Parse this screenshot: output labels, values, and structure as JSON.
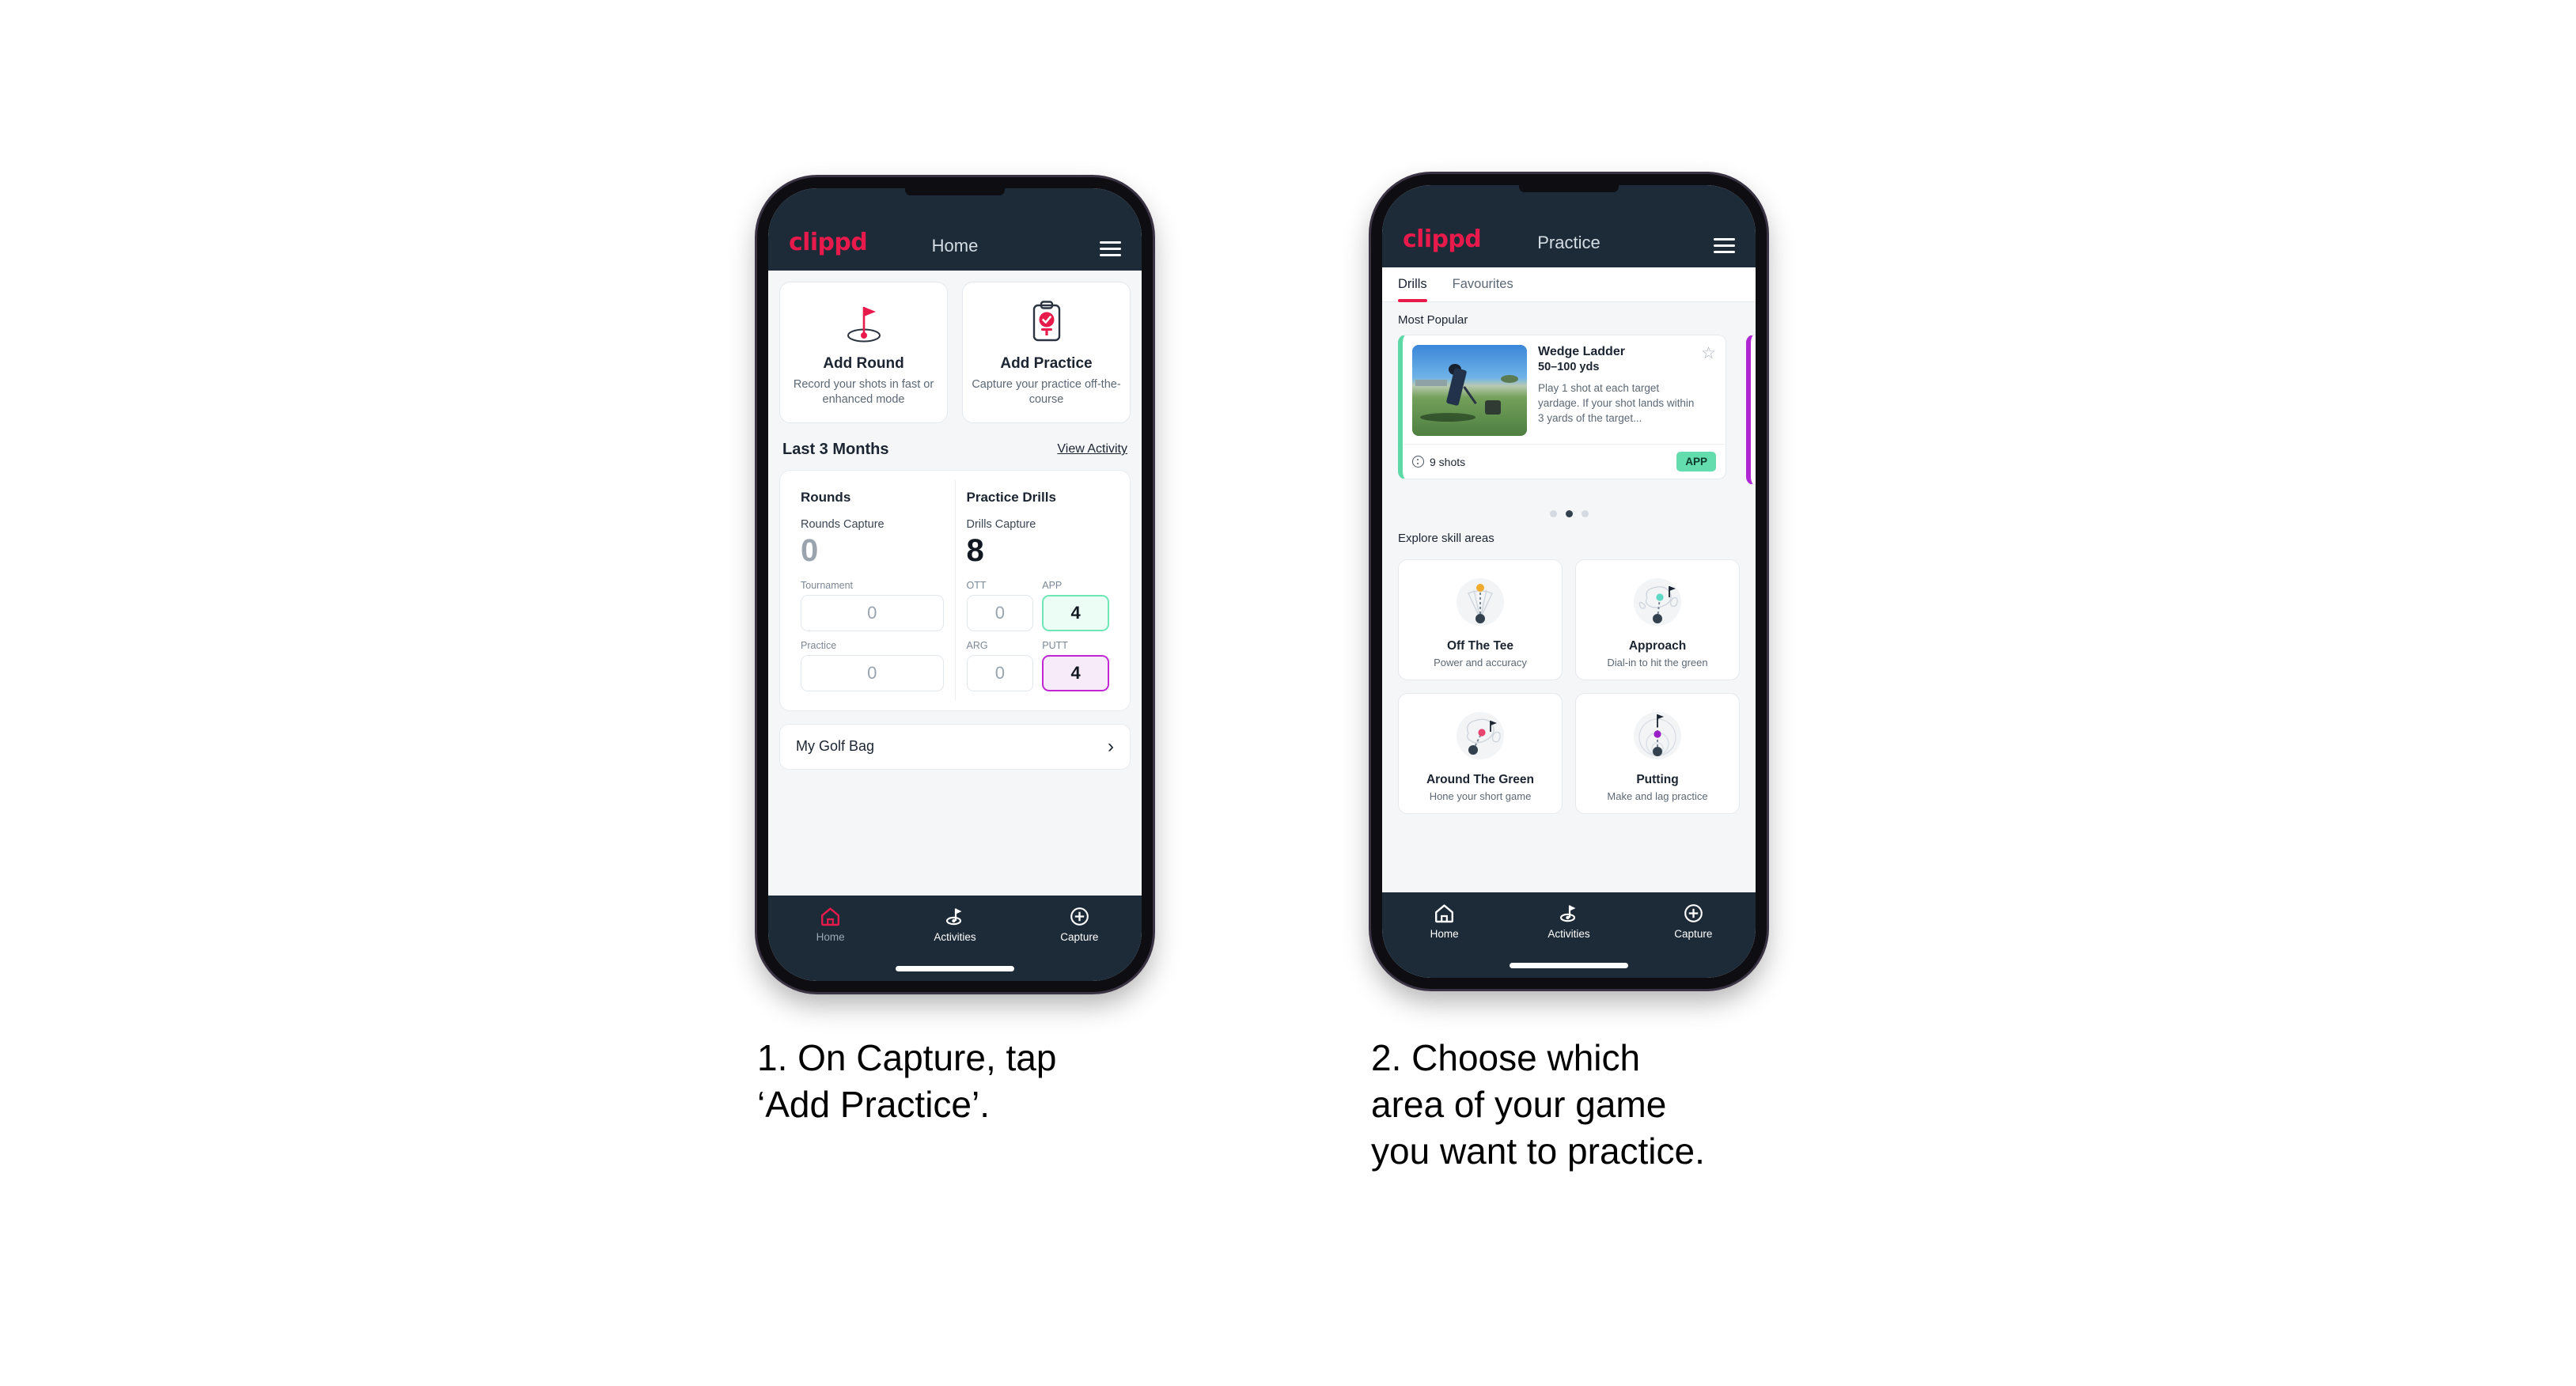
{
  "phone1": {
    "header": {
      "brand": "clippd",
      "title": "Home",
      "menu_icon": "hamburger-menu-icon"
    },
    "actions": [
      {
        "icon": "golf-flag-hole-icon",
        "title": "Add Round",
        "subtitle": "Record your shots in fast or enhanced mode"
      },
      {
        "icon": "clipboard-check-tee-icon",
        "title": "Add Practice",
        "subtitle": "Capture your practice off-the-course"
      }
    ],
    "section": {
      "title": "Last 3 Months",
      "link": "View Activity"
    },
    "rounds": {
      "heading": "Rounds",
      "capture_label": "Rounds Capture",
      "capture_value": "0",
      "metrics": [
        {
          "label": "Tournament",
          "value": "0",
          "state": "empty"
        },
        {
          "label": "Practice",
          "value": "0",
          "state": "empty"
        }
      ]
    },
    "drills": {
      "heading": "Practice Drills",
      "capture_label": "Drills Capture",
      "capture_value": "8",
      "metrics": [
        {
          "label": "OTT",
          "value": "0",
          "state": "empty"
        },
        {
          "label": "APP",
          "value": "4",
          "state": "app"
        },
        {
          "label": "ARG",
          "value": "0",
          "state": "empty"
        },
        {
          "label": "PUTT",
          "value": "4",
          "state": "putt"
        }
      ]
    },
    "golf_bag": {
      "label": "My Golf Bag",
      "chevron": "chevron-right-icon"
    },
    "nav": [
      {
        "icon": "home-icon",
        "label": "Home",
        "active": true
      },
      {
        "icon": "golf-flag-icon",
        "label": "Activities",
        "active": false
      },
      {
        "icon": "plus-circle-icon",
        "label": "Capture",
        "active": false
      }
    ]
  },
  "phone2": {
    "header": {
      "brand": "clippd",
      "title": "Practice",
      "menu_icon": "hamburger-menu-icon"
    },
    "tabs": [
      {
        "label": "Drills",
        "active": true
      },
      {
        "label": "Favourites",
        "active": false
      }
    ],
    "most_popular_label": "Most Popular",
    "drill": {
      "name": "Wedge Ladder",
      "yardage": "50–100 yds",
      "description": "Play 1 shot at each target yardage. If your shot lands within 3 yards of the target...",
      "shots": "9 shots",
      "tag": "APP",
      "star_icon": "star-outline-icon",
      "clock_icon": "shots-count-icon",
      "accent_color": "#5fd8a8",
      "tag_color": "#63dcae"
    },
    "pagination": {
      "count": 3,
      "active_index": 1
    },
    "explore_label": "Explore skill areas",
    "skills": [
      {
        "icon": "off-the-tee-icon",
        "name": "Off The Tee",
        "subtitle": "Power and accuracy",
        "dot_color": "#f0ab2e"
      },
      {
        "icon": "approach-icon",
        "name": "Approach",
        "subtitle": "Dial-in to hit the green",
        "dot_color": "#5fd8c4"
      },
      {
        "icon": "around-the-green-icon",
        "name": "Around The Green",
        "subtitle": "Hone your short game",
        "dot_color": "#e8446f"
      },
      {
        "icon": "putting-icon",
        "name": "Putting",
        "subtitle": "Make and lag practice",
        "dot_color": "#9b1fc7"
      }
    ],
    "nav": [
      {
        "icon": "home-icon",
        "label": "Home",
        "active": false
      },
      {
        "icon": "golf-flag-icon",
        "label": "Activities",
        "active": false
      },
      {
        "icon": "plus-circle-icon",
        "label": "Capture",
        "active": false
      }
    ]
  },
  "captions": {
    "step1": "1. On Capture, tap\n‘Add Practice’.",
    "step2": "2. Choose which\narea of your game\nyou want to practice."
  },
  "colors": {
    "brand_pink": "#e8194b",
    "header_dark": "#1d2b38",
    "app_green": "#6ee7b7",
    "putt_purple": "#c026d3"
  }
}
